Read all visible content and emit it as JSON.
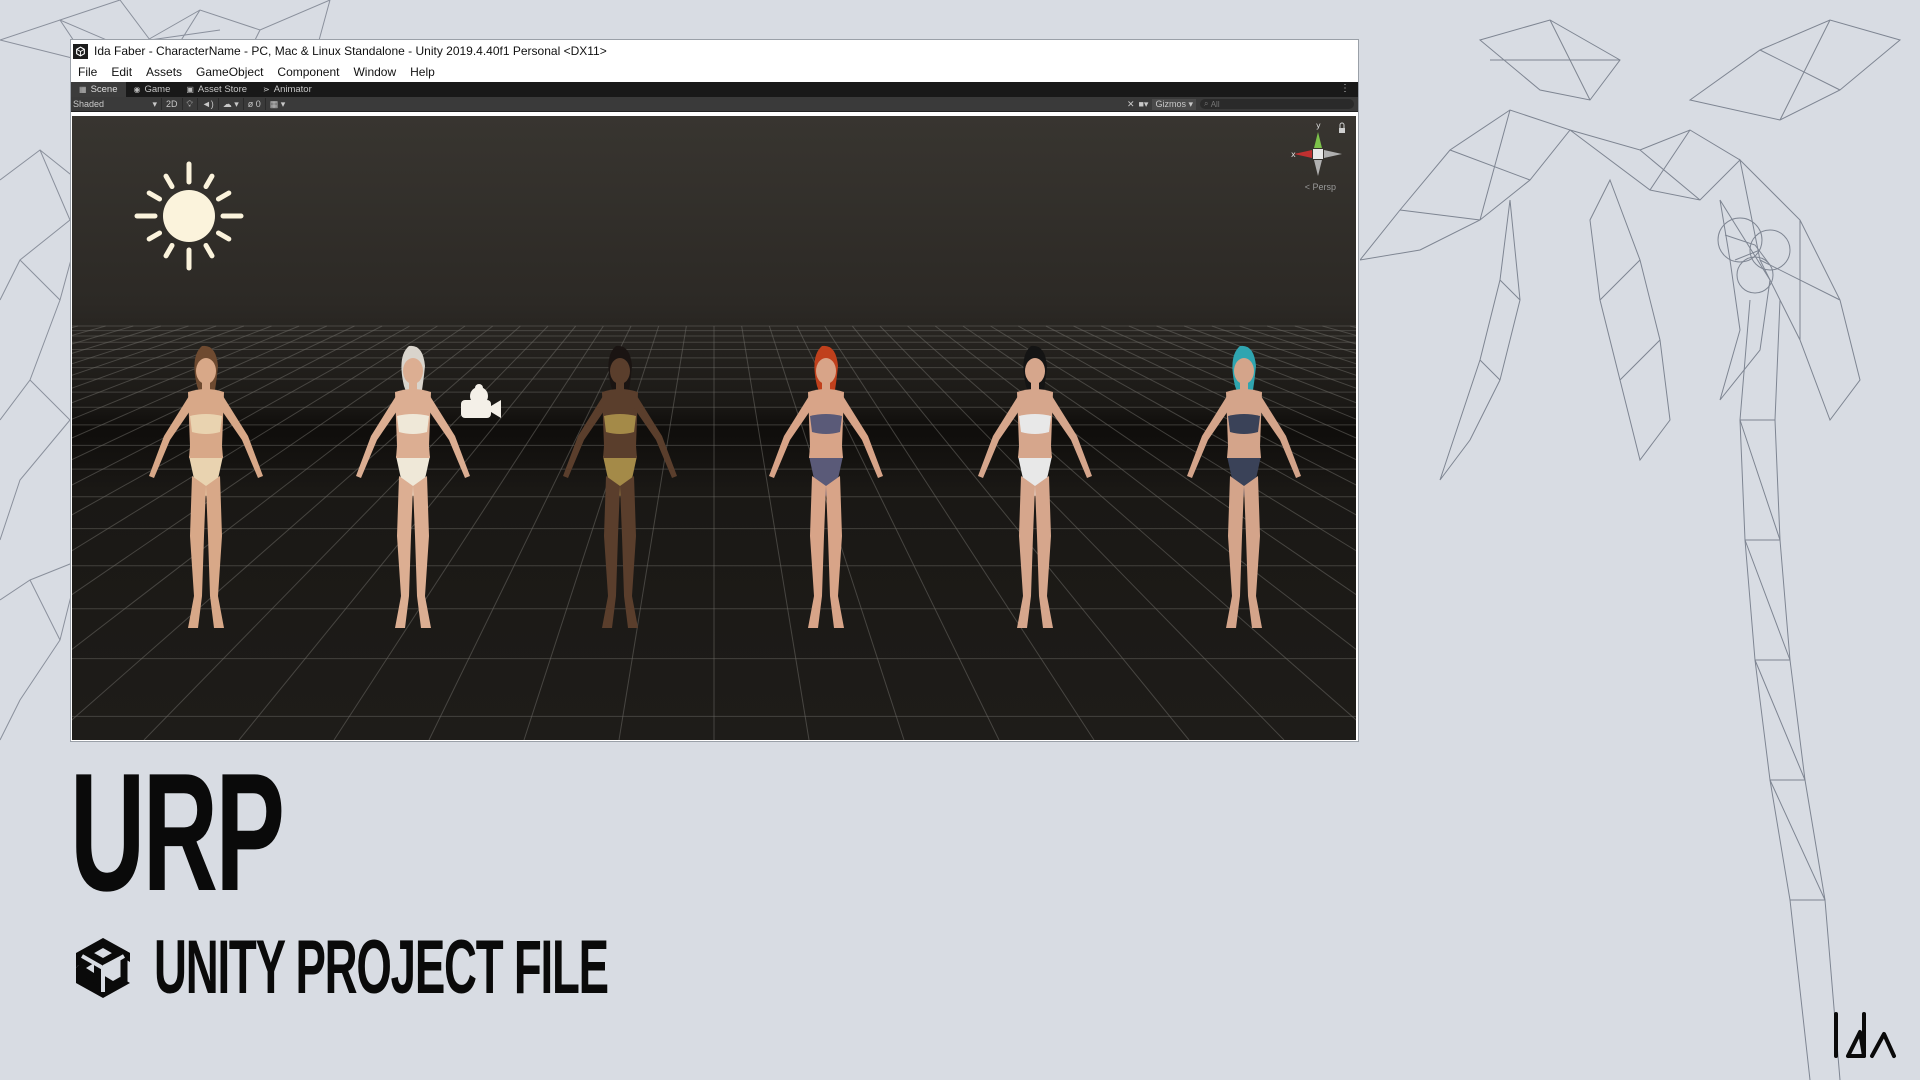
{
  "window": {
    "title": "Ida Faber - CharacterName - PC, Mac & Linux Standalone - Unity 2019.4.40f1 Personal <DX11>",
    "menu": [
      "File",
      "Edit",
      "Assets",
      "GameObject",
      "Component",
      "Window",
      "Help"
    ],
    "tabs": [
      {
        "label": "Scene",
        "icon": "scene-icon"
      },
      {
        "label": "Game",
        "icon": "gamepad-icon"
      },
      {
        "label": "Asset Store",
        "icon": "store-icon"
      },
      {
        "label": "Animator",
        "icon": "animator-icon"
      }
    ],
    "toolbar": {
      "shading_mode": "Shaded",
      "mode_2d": "2D",
      "hidden_count": "0",
      "gizmos_label": "Gizmos",
      "search_placeholder": "All"
    },
    "gizmo": {
      "persp_label": "Persp",
      "x_label": "x",
      "y_label": "y"
    }
  },
  "scene": {
    "characters": [
      {
        "name": "character-1",
        "hair": "#6e4a30",
        "suit": "#e9d3b0",
        "skin": "#d8a888"
      },
      {
        "name": "character-2",
        "hair": "#d9d4cc",
        "suit": "#efe8d8",
        "skin": "#dcae92"
      },
      {
        "name": "character-3",
        "hair": "#1a1412",
        "suit": "#a48a48",
        "skin": "#5a3e2c"
      },
      {
        "name": "character-4",
        "hair": "#c0401c",
        "suit": "#5a5a78",
        "skin": "#d8a488"
      },
      {
        "name": "character-5",
        "hair": "#141414",
        "suit": "#e8e8e8",
        "skin": "#d6a68c"
      },
      {
        "name": "character-6",
        "hair": "#2fa5b0",
        "suit": "#3a4258",
        "skin": "#d4a48a"
      }
    ]
  },
  "slide": {
    "heading": "URP",
    "subheading": "UNITY PROJECT FILE"
  },
  "colors": {
    "background": "#d8dce3",
    "viewport_sky": "#383530",
    "viewport_floor": "#1e1c19",
    "grid": "#6a6863",
    "sun": "#fbf3dc",
    "heading": "#0a0a0a"
  }
}
